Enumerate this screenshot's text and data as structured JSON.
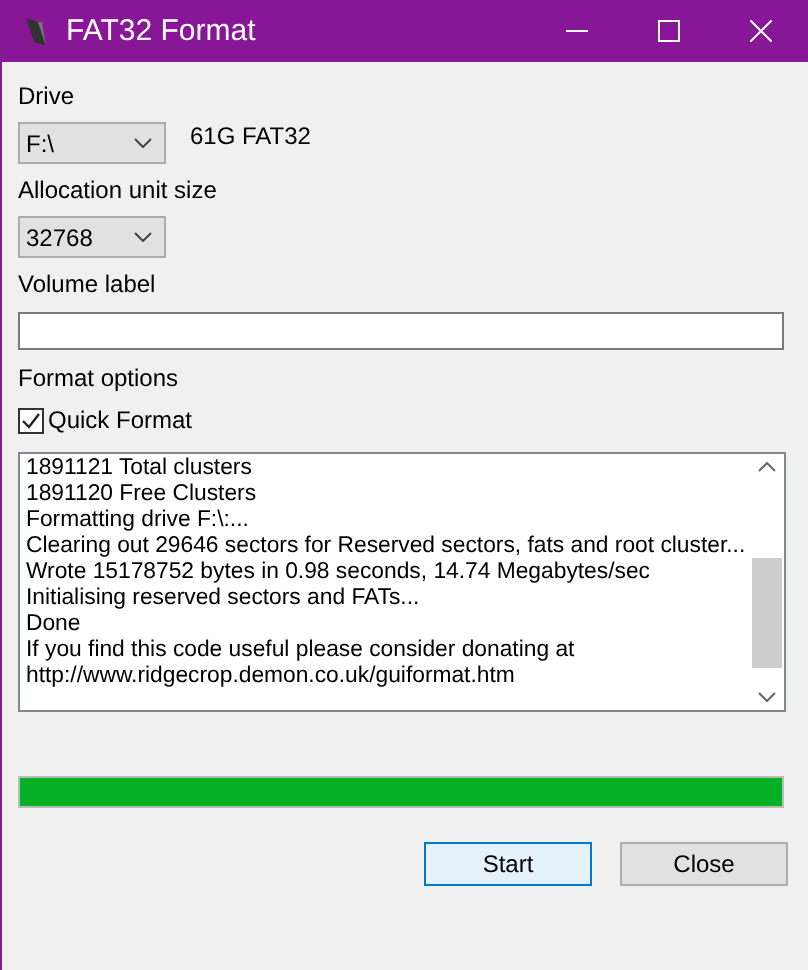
{
  "window": {
    "title": "FAT32 Format"
  },
  "drive": {
    "label": "Drive",
    "value": "F:\\",
    "info": "61G FAT32"
  },
  "allocation": {
    "label": "Allocation unit size",
    "value": "32768"
  },
  "volume": {
    "label": "Volume label"
  },
  "format_options": {
    "label": "Format options",
    "quick_format": {
      "label": "Quick Format",
      "checked": true
    }
  },
  "log": [
    "1891121 Total clusters",
    "1891120 Free Clusters",
    "Formatting drive F:\\:...",
    "Clearing out 29646 sectors for Reserved sectors, fats and root cluster...",
    "Wrote 15178752 bytes in 0.98 seconds, 14.74 Megabytes/sec",
    "Initialising reserved sectors and FATs...",
    "Done",
    "If you find this code useful please consider donating at",
    "http://www.ridgecrop.demon.co.uk/guiformat.htm"
  ],
  "progress": {
    "level": 1
  },
  "buttons": [
    {
      "label": "Start",
      "kind": "default"
    },
    {
      "label": "Close",
      "kind": "normal"
    }
  ]
}
